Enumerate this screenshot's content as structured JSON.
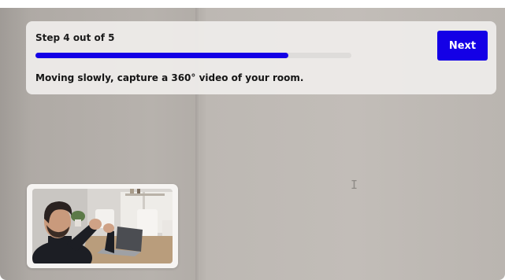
{
  "step": {
    "label": "Step 4 out of 5",
    "current": 4,
    "total": 5,
    "progress_percent": 80
  },
  "instruction": "Moving slowly, capture a 360° video of your room.",
  "next_button": {
    "label": "Next"
  },
  "colors": {
    "accent": "#1400e6",
    "progress_track": "#dedcda",
    "card_background": "#eeecea"
  },
  "icons": {
    "cursor": "text-cursor-icon"
  },
  "self_view": {
    "description_icon": "camera-self-view"
  }
}
